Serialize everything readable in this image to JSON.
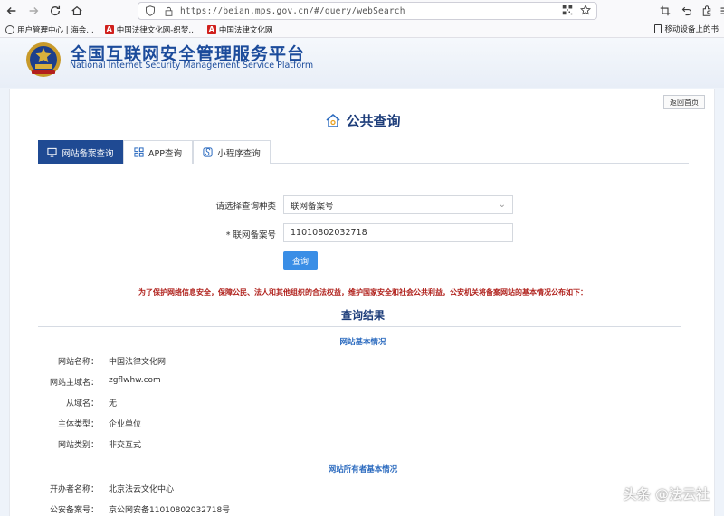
{
  "browser": {
    "url": "https://beian.mps.gov.cn/#/query/webSearch",
    "bookmarks": [
      {
        "label": "用户管理中心 | 海会…"
      },
      {
        "label": "中国法律文化网-织梦…"
      },
      {
        "label": "中国法律文化网"
      }
    ],
    "mobile_bookmarks": "移动设备上的书"
  },
  "site": {
    "title_cn": "全国互联网安全管理服务平台",
    "title_en": "National Internet Security Management Service Platform",
    "back_home": "返回首页"
  },
  "query": {
    "title": "公共查询",
    "tabs": [
      {
        "label": "网站备案查询"
      },
      {
        "label": "APP查询"
      },
      {
        "label": "小程序查询"
      }
    ],
    "type_label": "请选择查询种类",
    "type_value": "联网备案号",
    "record_label": "* 联网备案号",
    "record_value": "11010802032718",
    "submit": "查询"
  },
  "notice": "为了保护网络信息安全，保障公民、法人和其他组织的合法权益，维护国家安全和社会公共利益，公安机关将备案网站的基本情况公布如下：",
  "results": {
    "title": "查询结果",
    "basic_title": "网站基本情况",
    "basic": [
      {
        "label": "网站名称：",
        "value": "中国法律文化网"
      },
      {
        "label": "网站主域名：",
        "value": "zgflwhw.com"
      },
      {
        "label": "从域名：",
        "value": "无"
      },
      {
        "label": "主体类型：",
        "value": "企业单位"
      },
      {
        "label": "网站类别：",
        "value": "非交互式"
      }
    ],
    "owner_title": "网站所有者基本情况",
    "owner": [
      {
        "label": "开办者名称：",
        "value": "北京法云文化中心"
      },
      {
        "label": "公安备案号：",
        "value": "京公网安备11010802032718号"
      }
    ]
  },
  "watermark": "头条 @法云社"
}
